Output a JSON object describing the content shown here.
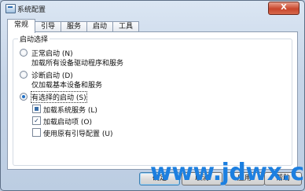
{
  "window": {
    "title": "系统配置",
    "close_label": "X"
  },
  "tabs": [
    {
      "label": "常规",
      "active": true
    },
    {
      "label": "引导",
      "active": false
    },
    {
      "label": "服务",
      "active": false
    },
    {
      "label": "启动",
      "active": false
    },
    {
      "label": "工具",
      "active": false
    }
  ],
  "startup_selection": {
    "title": "启动选择",
    "normal": {
      "label": "正常启动 (N)",
      "desc": "加载所有设备驱动程序和服务",
      "checked": false
    },
    "diagnostic": {
      "label": "诊断启动 (D)",
      "desc": "仅加载基本设备和服务",
      "checked": false
    },
    "selective": {
      "label": "有选择的启动 (S)",
      "checked": true,
      "options": [
        {
          "label": "加载系统服务 (L)",
          "state": "indeterminate"
        },
        {
          "label": "加载启动项 (O)",
          "state": "checked"
        },
        {
          "label": "使用原有引导配置 (U)",
          "state": "unchecked"
        }
      ]
    }
  },
  "buttons": {
    "ok": "确定",
    "cancel": "取消",
    "apply": "应用",
    "help": "帮助"
  },
  "watermark": {
    "text": "www.jdwx.cn",
    "color": "#1c7fe0"
  }
}
